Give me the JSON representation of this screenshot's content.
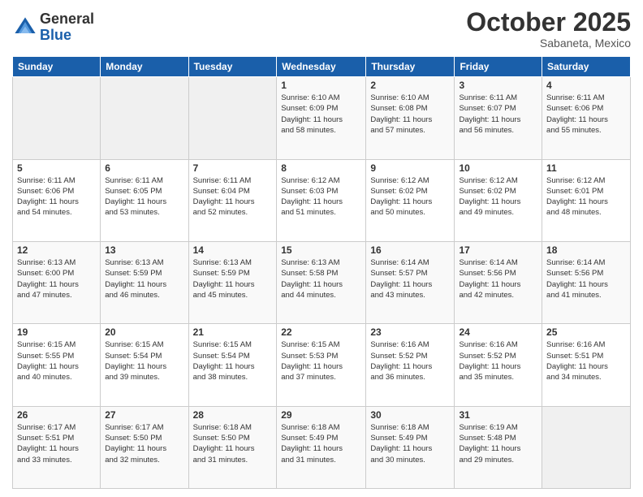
{
  "logo": {
    "general": "General",
    "blue": "Blue"
  },
  "header": {
    "month": "October 2025",
    "location": "Sabaneta, Mexico"
  },
  "weekdays": [
    "Sunday",
    "Monday",
    "Tuesday",
    "Wednesday",
    "Thursday",
    "Friday",
    "Saturday"
  ],
  "weeks": [
    [
      {
        "day": "",
        "info": ""
      },
      {
        "day": "",
        "info": ""
      },
      {
        "day": "",
        "info": ""
      },
      {
        "day": "1",
        "info": "Sunrise: 6:10 AM\nSunset: 6:09 PM\nDaylight: 11 hours\nand 58 minutes."
      },
      {
        "day": "2",
        "info": "Sunrise: 6:10 AM\nSunset: 6:08 PM\nDaylight: 11 hours\nand 57 minutes."
      },
      {
        "day": "3",
        "info": "Sunrise: 6:11 AM\nSunset: 6:07 PM\nDaylight: 11 hours\nand 56 minutes."
      },
      {
        "day": "4",
        "info": "Sunrise: 6:11 AM\nSunset: 6:06 PM\nDaylight: 11 hours\nand 55 minutes."
      }
    ],
    [
      {
        "day": "5",
        "info": "Sunrise: 6:11 AM\nSunset: 6:06 PM\nDaylight: 11 hours\nand 54 minutes."
      },
      {
        "day": "6",
        "info": "Sunrise: 6:11 AM\nSunset: 6:05 PM\nDaylight: 11 hours\nand 53 minutes."
      },
      {
        "day": "7",
        "info": "Sunrise: 6:11 AM\nSunset: 6:04 PM\nDaylight: 11 hours\nand 52 minutes."
      },
      {
        "day": "8",
        "info": "Sunrise: 6:12 AM\nSunset: 6:03 PM\nDaylight: 11 hours\nand 51 minutes."
      },
      {
        "day": "9",
        "info": "Sunrise: 6:12 AM\nSunset: 6:02 PM\nDaylight: 11 hours\nand 50 minutes."
      },
      {
        "day": "10",
        "info": "Sunrise: 6:12 AM\nSunset: 6:02 PM\nDaylight: 11 hours\nand 49 minutes."
      },
      {
        "day": "11",
        "info": "Sunrise: 6:12 AM\nSunset: 6:01 PM\nDaylight: 11 hours\nand 48 minutes."
      }
    ],
    [
      {
        "day": "12",
        "info": "Sunrise: 6:13 AM\nSunset: 6:00 PM\nDaylight: 11 hours\nand 47 minutes."
      },
      {
        "day": "13",
        "info": "Sunrise: 6:13 AM\nSunset: 5:59 PM\nDaylight: 11 hours\nand 46 minutes."
      },
      {
        "day": "14",
        "info": "Sunrise: 6:13 AM\nSunset: 5:59 PM\nDaylight: 11 hours\nand 45 minutes."
      },
      {
        "day": "15",
        "info": "Sunrise: 6:13 AM\nSunset: 5:58 PM\nDaylight: 11 hours\nand 44 minutes."
      },
      {
        "day": "16",
        "info": "Sunrise: 6:14 AM\nSunset: 5:57 PM\nDaylight: 11 hours\nand 43 minutes."
      },
      {
        "day": "17",
        "info": "Sunrise: 6:14 AM\nSunset: 5:56 PM\nDaylight: 11 hours\nand 42 minutes."
      },
      {
        "day": "18",
        "info": "Sunrise: 6:14 AM\nSunset: 5:56 PM\nDaylight: 11 hours\nand 41 minutes."
      }
    ],
    [
      {
        "day": "19",
        "info": "Sunrise: 6:15 AM\nSunset: 5:55 PM\nDaylight: 11 hours\nand 40 minutes."
      },
      {
        "day": "20",
        "info": "Sunrise: 6:15 AM\nSunset: 5:54 PM\nDaylight: 11 hours\nand 39 minutes."
      },
      {
        "day": "21",
        "info": "Sunrise: 6:15 AM\nSunset: 5:54 PM\nDaylight: 11 hours\nand 38 minutes."
      },
      {
        "day": "22",
        "info": "Sunrise: 6:15 AM\nSunset: 5:53 PM\nDaylight: 11 hours\nand 37 minutes."
      },
      {
        "day": "23",
        "info": "Sunrise: 6:16 AM\nSunset: 5:52 PM\nDaylight: 11 hours\nand 36 minutes."
      },
      {
        "day": "24",
        "info": "Sunrise: 6:16 AM\nSunset: 5:52 PM\nDaylight: 11 hours\nand 35 minutes."
      },
      {
        "day": "25",
        "info": "Sunrise: 6:16 AM\nSunset: 5:51 PM\nDaylight: 11 hours\nand 34 minutes."
      }
    ],
    [
      {
        "day": "26",
        "info": "Sunrise: 6:17 AM\nSunset: 5:51 PM\nDaylight: 11 hours\nand 33 minutes."
      },
      {
        "day": "27",
        "info": "Sunrise: 6:17 AM\nSunset: 5:50 PM\nDaylight: 11 hours\nand 32 minutes."
      },
      {
        "day": "28",
        "info": "Sunrise: 6:18 AM\nSunset: 5:50 PM\nDaylight: 11 hours\nand 31 minutes."
      },
      {
        "day": "29",
        "info": "Sunrise: 6:18 AM\nSunset: 5:49 PM\nDaylight: 11 hours\nand 31 minutes."
      },
      {
        "day": "30",
        "info": "Sunrise: 6:18 AM\nSunset: 5:49 PM\nDaylight: 11 hours\nand 30 minutes."
      },
      {
        "day": "31",
        "info": "Sunrise: 6:19 AM\nSunset: 5:48 PM\nDaylight: 11 hours\nand 29 minutes."
      },
      {
        "day": "",
        "info": ""
      }
    ]
  ]
}
